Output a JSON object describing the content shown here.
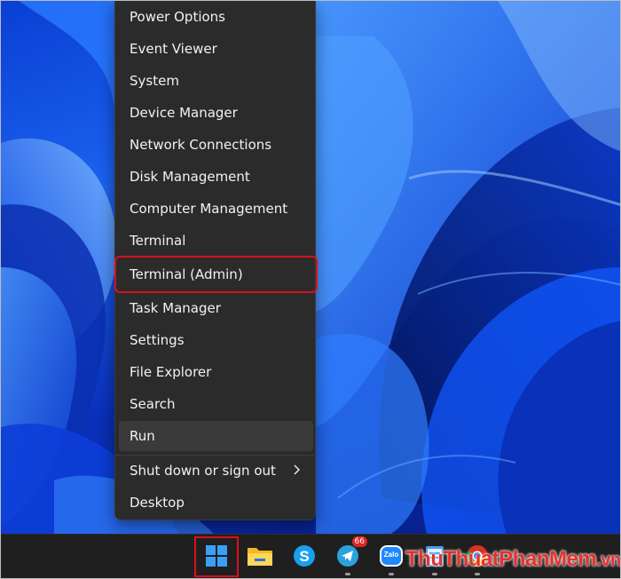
{
  "context_menu": {
    "items": [
      {
        "label": "Power Options"
      },
      {
        "label": "Event Viewer"
      },
      {
        "label": "System"
      },
      {
        "label": "Device Manager"
      },
      {
        "label": "Network Connections"
      },
      {
        "label": "Disk Management"
      },
      {
        "label": "Computer Management"
      },
      {
        "label": "Terminal"
      },
      {
        "label": "Terminal (Admin)",
        "highlighted": true
      },
      {
        "label": "Task Manager"
      },
      {
        "label": "Settings"
      },
      {
        "label": "File Explorer"
      },
      {
        "label": "Search"
      },
      {
        "label": "Run",
        "hover": true
      },
      {
        "label": "Shut down or sign out",
        "submenu": true
      },
      {
        "label": "Desktop"
      }
    ]
  },
  "taskbar": {
    "icons": [
      {
        "name": "start-icon",
        "highlighted": true
      },
      {
        "name": "file-explorer-icon"
      },
      {
        "name": "skype-icon"
      },
      {
        "name": "telegram-icon",
        "badge": "66"
      },
      {
        "name": "zalo-icon",
        "label": "Zalo"
      },
      {
        "name": "notepad-icon"
      },
      {
        "name": "chrome-icon"
      }
    ]
  },
  "watermark": {
    "text_main": "ThuThuatPhanMem",
    "text_tld": ".vn"
  },
  "colors": {
    "menu_bg": "#2b2b2b",
    "highlight": "#d8101c",
    "taskbar_bg": "#1f1f1f",
    "wallpaper_blue": "#1b63f0"
  }
}
